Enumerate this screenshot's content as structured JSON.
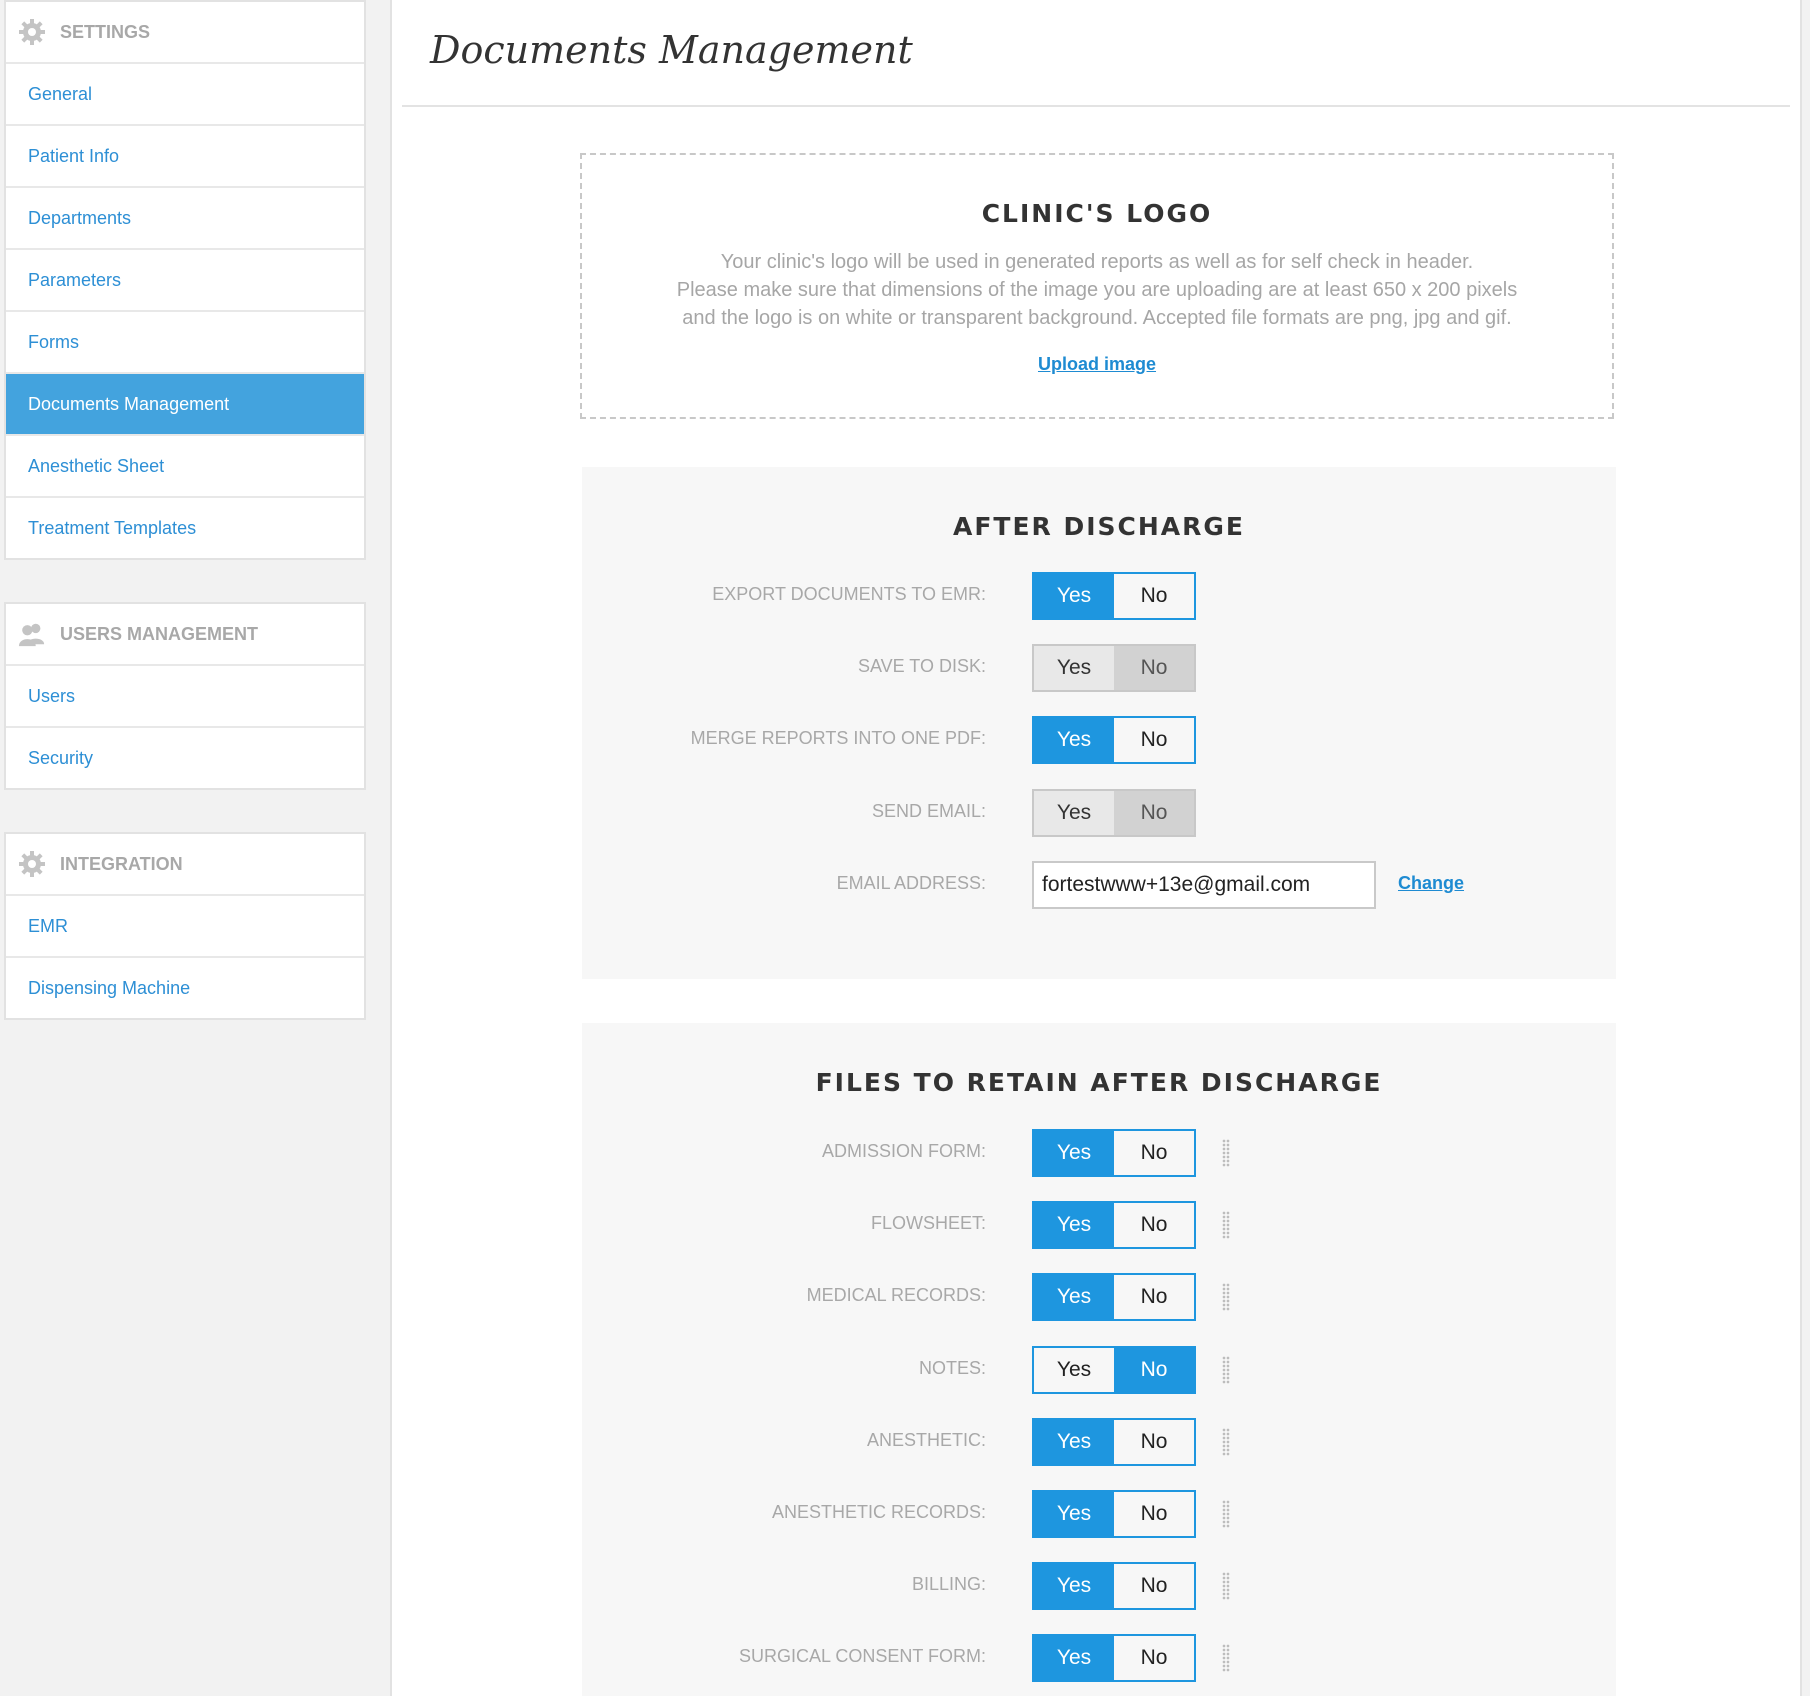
{
  "sidebar": {
    "settings": {
      "header": "SETTINGS",
      "icon": "gear-icon",
      "items": [
        "General",
        "Patient Info",
        "Departments",
        "Parameters",
        "Forms",
        "Documents Management",
        "Anesthetic Sheet",
        "Treatment Templates"
      ],
      "active": "Documents Management"
    },
    "users": {
      "header": "USERS MANAGEMENT",
      "icon": "users-icon",
      "items": [
        "Users",
        "Security"
      ]
    },
    "integration": {
      "header": "INTEGRATION",
      "icon": "gear-icon",
      "items": [
        "EMR",
        "Dispensing Machine"
      ]
    }
  },
  "main": {
    "title": "Documents Management",
    "logo": {
      "title": "CLINIC'S LOGO",
      "desc1": "Your clinic's logo will be used in generated reports as well as for self check in header.",
      "desc2": "Please make sure that dimensions of the image you are uploading are at least 650 x 200 pixels",
      "desc3": "and the logo is on white or transparent background. Accepted file formats are png, jpg and gif.",
      "upload": "Upload image"
    },
    "after_discharge": {
      "title": "AFTER DISCHARGE",
      "export": {
        "label": "EXPORT DOCUMENTS TO EMR:",
        "value": "Yes"
      },
      "save_disk": {
        "label": "SAVE TO DISK:",
        "value": "disabled"
      },
      "merge": {
        "label": "MERGE REPORTS INTO ONE PDF:",
        "value": "Yes"
      },
      "send_email": {
        "label": "SEND EMAIL:",
        "value": "disabled"
      },
      "email": {
        "label": "EMAIL ADDRESS:",
        "value": "fortestwww+13e@gmail.com",
        "change": "Change"
      }
    },
    "retain": {
      "title": "FILES TO RETAIN AFTER DISCHARGE",
      "items": [
        {
          "label": "ADMISSION FORM:",
          "value": "Yes"
        },
        {
          "label": "FLOWSHEET:",
          "value": "Yes"
        },
        {
          "label": "MEDICAL RECORDS:",
          "value": "Yes"
        },
        {
          "label": "NOTES:",
          "value": "No"
        },
        {
          "label": "ANESTHETIC:",
          "value": "Yes"
        },
        {
          "label": "ANESTHETIC RECORDS:",
          "value": "Yes"
        },
        {
          "label": "BILLING:",
          "value": "Yes"
        },
        {
          "label": "SURGICAL CONSENT FORM:",
          "value": "Yes"
        }
      ]
    },
    "toggle": {
      "yes": "Yes",
      "no": "No"
    }
  },
  "colors": {
    "accent": "#1e96df",
    "active_nav": "#43a3de",
    "link": "#2d8fd5"
  }
}
